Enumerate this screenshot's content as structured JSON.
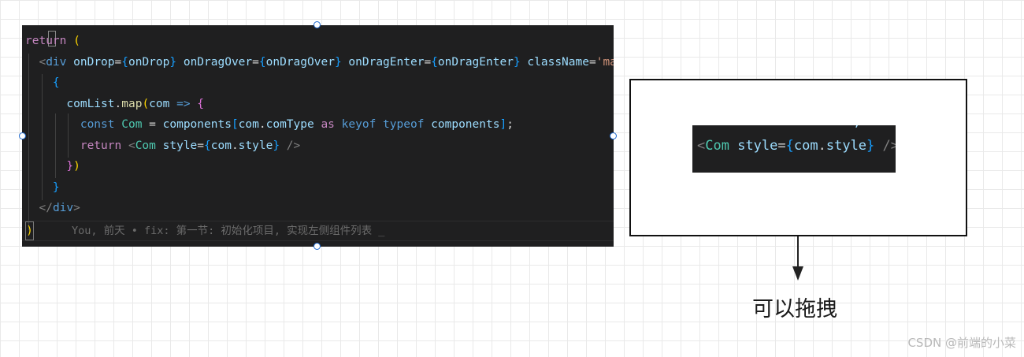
{
  "code_panel": {
    "lines": [
      [
        {
          "t": "return ",
          "c": "kw"
        },
        {
          "t": "(",
          "c": "brk"
        }
      ],
      [
        {
          "t": "  ",
          "c": ""
        },
        {
          "t": "<",
          "c": "tag"
        },
        {
          "t": "div ",
          "c": "kb"
        },
        {
          "t": "onDrop",
          "c": "var"
        },
        {
          "t": "=",
          "c": ""
        },
        {
          "t": "{",
          "c": "blu"
        },
        {
          "t": "onDrop",
          "c": "var"
        },
        {
          "t": "} ",
          "c": "blu"
        },
        {
          "t": "onDragOver",
          "c": "var"
        },
        {
          "t": "=",
          "c": ""
        },
        {
          "t": "{",
          "c": "blu"
        },
        {
          "t": "onDragOver",
          "c": "var"
        },
        {
          "t": "} ",
          "c": "blu"
        },
        {
          "t": "onDragEnter",
          "c": "var"
        },
        {
          "t": "=",
          "c": ""
        },
        {
          "t": "{",
          "c": "blu"
        },
        {
          "t": "onDragEnter",
          "c": "var"
        },
        {
          "t": "} ",
          "c": "blu"
        },
        {
          "t": "className",
          "c": "var"
        },
        {
          "t": "=",
          "c": ""
        },
        {
          "t": "'mainCom'",
          "c": "str"
        },
        {
          "t": ">",
          "c": "tag"
        }
      ],
      [
        {
          "t": "    ",
          "c": ""
        },
        {
          "t": "{",
          "c": "blu"
        }
      ],
      [
        {
          "t": "      ",
          "c": ""
        },
        {
          "t": "comList",
          "c": "var"
        },
        {
          "t": ".",
          "c": ""
        },
        {
          "t": "map",
          "c": "fn"
        },
        {
          "t": "(",
          "c": "brk"
        },
        {
          "t": "com ",
          "c": "var"
        },
        {
          "t": "=> ",
          "c": "kb"
        },
        {
          "t": "{",
          "c": "pnk"
        }
      ],
      [
        {
          "t": "        ",
          "c": ""
        },
        {
          "t": "const ",
          "c": "kb"
        },
        {
          "t": "Com ",
          "c": "ty"
        },
        {
          "t": "= ",
          "c": ""
        },
        {
          "t": "components",
          "c": "var"
        },
        {
          "t": "[",
          "c": "blu"
        },
        {
          "t": "com",
          "c": "var"
        },
        {
          "t": ".",
          "c": ""
        },
        {
          "t": "comType ",
          "c": "var"
        },
        {
          "t": "as ",
          "c": "kw"
        },
        {
          "t": "keyof ",
          "c": "kb"
        },
        {
          "t": "typeof ",
          "c": "kb"
        },
        {
          "t": "components",
          "c": "var"
        },
        {
          "t": "]",
          "c": "blu"
        },
        {
          "t": ";",
          "c": ""
        }
      ],
      [
        {
          "t": "        ",
          "c": ""
        },
        {
          "t": "return ",
          "c": "kw"
        },
        {
          "t": "<",
          "c": "tag"
        },
        {
          "t": "Com ",
          "c": "ty"
        },
        {
          "t": "style",
          "c": "var"
        },
        {
          "t": "=",
          "c": ""
        },
        {
          "t": "{",
          "c": "blu"
        },
        {
          "t": "com",
          "c": "var"
        },
        {
          "t": ".",
          "c": ""
        },
        {
          "t": "style",
          "c": "var"
        },
        {
          "t": "} ",
          "c": "blu"
        },
        {
          "t": "/>",
          "c": "tag"
        }
      ],
      [
        {
          "t": "      ",
          "c": ""
        },
        {
          "t": "}",
          "c": "pnk"
        },
        {
          "t": ")",
          "c": "brk"
        }
      ],
      [
        {
          "t": "    ",
          "c": ""
        },
        {
          "t": "}",
          "c": "blu"
        }
      ],
      [
        {
          "t": "  ",
          "c": ""
        },
        {
          "t": "</",
          "c": "tag"
        },
        {
          "t": "div",
          "c": "kb"
        },
        {
          "t": ">",
          "c": "tag"
        }
      ]
    ],
    "blame_bracket": ")",
    "blame_text": "You, 前天 • fix: 第一节: 初始化项目, 实现左侧组件列表 _"
  },
  "snippet": {
    "top_fragment": "              ,",
    "line": [
      {
        "t": "<",
        "c": "tag"
      },
      {
        "t": "Com ",
        "c": "ty"
      },
      {
        "t": "style",
        "c": "var"
      },
      {
        "t": "=",
        "c": ""
      },
      {
        "t": "{",
        "c": "blu"
      },
      {
        "t": "com",
        "c": "var"
      },
      {
        "t": ".",
        "c": ""
      },
      {
        "t": "style",
        "c": "var"
      },
      {
        "t": "} ",
        "c": "blu"
      },
      {
        "t": "/>",
        "c": "tag"
      }
    ]
  },
  "annotation": {
    "label": "可以拖拽"
  },
  "watermark": "CSDN @前端的小菜"
}
